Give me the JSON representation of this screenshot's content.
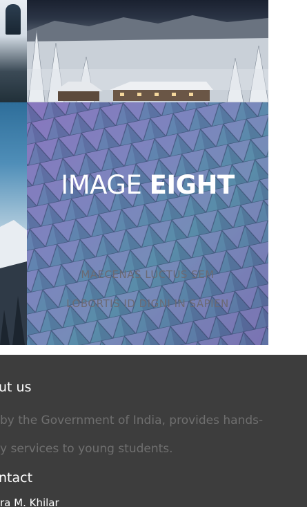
{
  "gallery": {
    "tile_title_light": "IMAGE",
    "tile_title_bold": "EIGHT",
    "tile_line_1": "MAECENAS LUCTUS SEM",
    "tile_line_2": "LOBORTIS ID DIGNI IN SAPIEN"
  },
  "footer": {
    "about_heading": "ut us",
    "about_line_1": "by the Government of India, provides hands-",
    "about_line_2": "y services to young students.",
    "contact_heading": "ntact",
    "contact_name": "ra M. Khilar"
  },
  "colors": {
    "footer_bg": "#3d3d3d",
    "tile_purple": "#7a60b6",
    "tile_teal": "#3a7e9e"
  }
}
